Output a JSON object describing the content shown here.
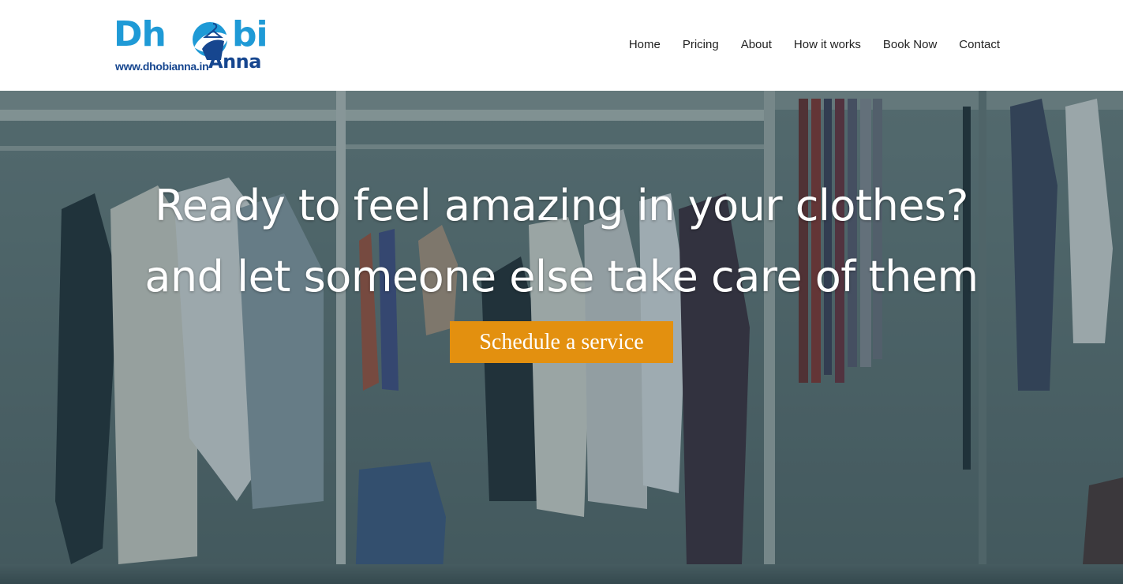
{
  "brand": {
    "logo_part1": "Dh",
    "logo_part2": "bi",
    "logo_url": "www.dhobianna.in",
    "logo_sub": "Anna",
    "colors": {
      "blue_light": "#1f9ad6",
      "blue_dark": "#16468f"
    }
  },
  "nav": {
    "items": [
      {
        "label": "Home"
      },
      {
        "label": "Pricing"
      },
      {
        "label": "About"
      },
      {
        "label": "How it works"
      },
      {
        "label": "Book Now"
      },
      {
        "label": "Contact"
      }
    ]
  },
  "hero": {
    "line1": "Ready to feel amazing in your clothes?",
    "line2": "and let someone else take care of them",
    "cta_label": "Schedule a service",
    "cta_color": "#e3900f",
    "background_image": "wardrobe-with-hanging-clothes"
  }
}
